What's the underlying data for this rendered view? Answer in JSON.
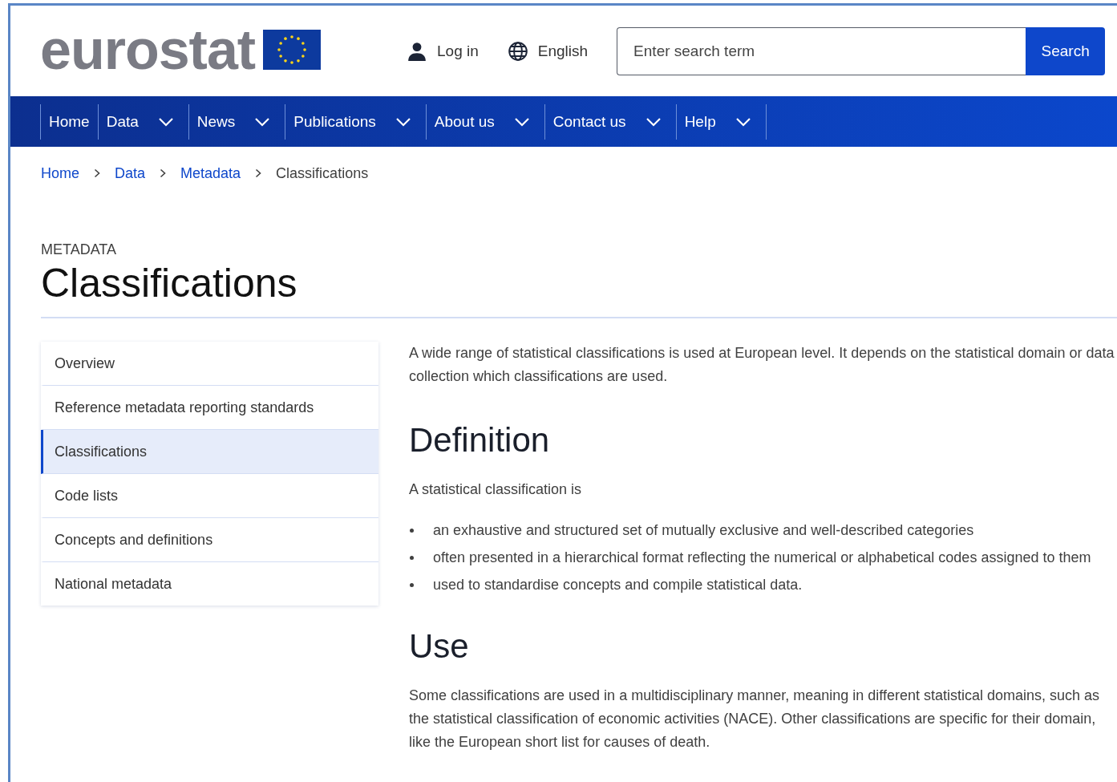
{
  "header": {
    "logo": "eurostat",
    "login": "Log in",
    "language": "English",
    "search": {
      "placeholder": "Enter search term",
      "button": "Search"
    }
  },
  "nav": [
    {
      "label": "Home",
      "dropdown": false
    },
    {
      "label": "Data",
      "dropdown": true
    },
    {
      "label": "News",
      "dropdown": true
    },
    {
      "label": "Publications",
      "dropdown": true
    },
    {
      "label": "About us",
      "dropdown": true
    },
    {
      "label": "Contact us",
      "dropdown": true
    },
    {
      "label": "Help",
      "dropdown": true
    }
  ],
  "breadcrumb": [
    {
      "label": "Home",
      "link": true
    },
    {
      "label": "Data",
      "link": true
    },
    {
      "label": "Metadata",
      "link": true
    },
    {
      "label": "Classifications",
      "link": false
    }
  ],
  "page": {
    "eyebrow": "METADATA",
    "title": "Classifications"
  },
  "sidebar": [
    {
      "label": "Overview",
      "selected": false
    },
    {
      "label": "Reference metadata reporting standards",
      "selected": false
    },
    {
      "label": "Classifications",
      "selected": true
    },
    {
      "label": "Code lists",
      "selected": false
    },
    {
      "label": "Concepts and definitions",
      "selected": false
    },
    {
      "label": "National metadata",
      "selected": false
    }
  ],
  "content": [
    {
      "kind": "paragraph",
      "text": "A wide range of statistical classifications is used at European level. It depends on the statistical domain or data collection which classifications are used."
    },
    {
      "kind": "heading",
      "text": "Definition"
    },
    {
      "kind": "paragraph",
      "text": "A statistical classification is"
    },
    {
      "kind": "list",
      "items": [
        "an exhaustive and structured set of mutually exclusive and well-described categories",
        "often presented in a hierarchical format reflecting the numerical or alphabetical codes assigned to them",
        "used to standardise concepts and compile statistical data."
      ]
    },
    {
      "kind": "heading",
      "text": "Use"
    },
    {
      "kind": "paragraph",
      "text": "Some classifications are used in a multidisciplinary manner, meaning in different statistical domains, such as the statistical classification of economic activities (NACE). Other classifications are specific for their domain, like the European short list for causes of death."
    }
  ]
}
